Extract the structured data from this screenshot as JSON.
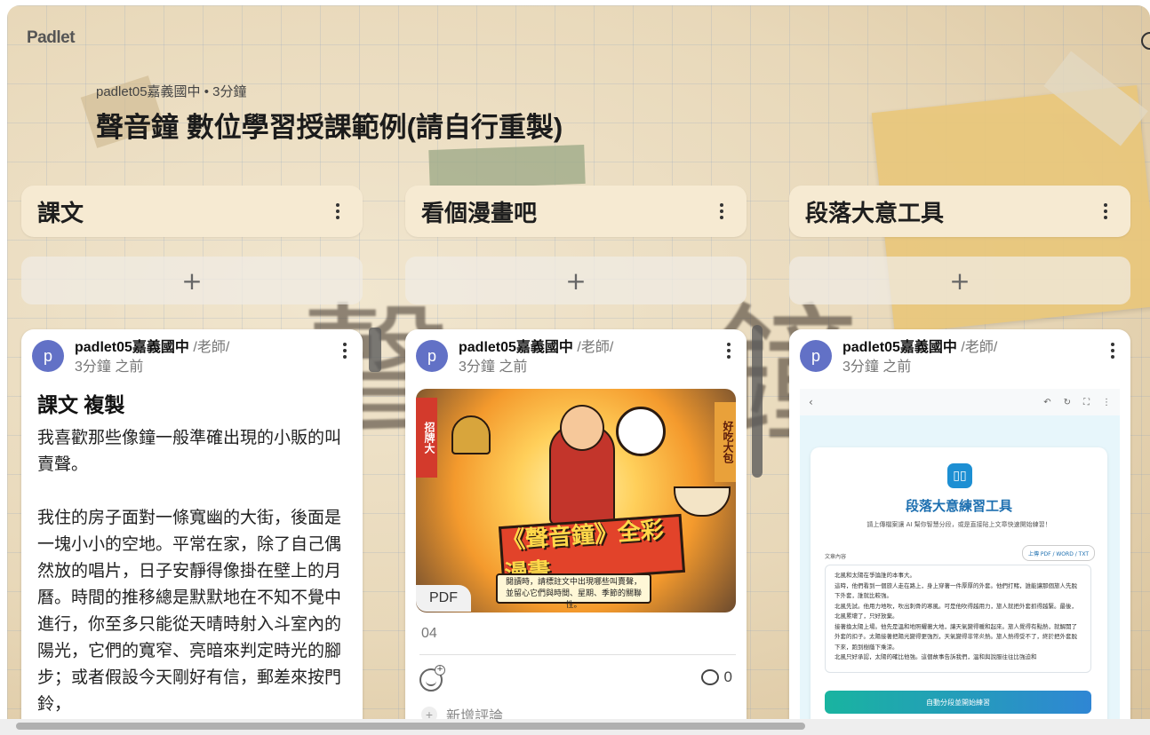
{
  "app": {
    "logo": "Padlet",
    "meta": "padlet05嘉義國中 • 3分鐘",
    "title": "聲音鐘 數位學習授課範例(請自行重製)"
  },
  "columns": [
    {
      "title": "課文",
      "add_symbol": "+",
      "post": {
        "avatar_letter": "p",
        "author": "padlet05嘉義國中",
        "role": "/老師/",
        "time": "3分鐘 之前",
        "title": "課文 複製",
        "body": "我喜歡那些像鐘一般準確出現的小販的叫賣聲。\n\n我住的房子面對一條寬幽的大街，後面是一塊小小的空地。平常在家，除了自己偶然放的唱片，日子安靜得像掛在壁上的月曆。時間的推移總是默默地在不知不覺中進行，你至多只能從天晴時射入斗室內的陽光，它們的寬窄、亮暗來判定時光的腳步；或者假設今天剛好有信，郵差來按門鈴，"
      }
    },
    {
      "title": "看個漫畫吧",
      "add_symbol": "+",
      "post": {
        "avatar_letter": "p",
        "author": "padlet05嘉義國中",
        "role": "/老師/",
        "time": "3分鐘 之前",
        "attachment": {
          "type_label": "PDF",
          "filename": "04",
          "headline": "《聲音鐘》全彩漫畫",
          "caption": "閱讀時，請標註文中出現哪些叫賣聲，並留心它們與時間、星期、季節的關聯性。",
          "sign_left": "招牌大",
          "sign_right": "好吃大包"
        },
        "comment_count": "0",
        "add_comment": "新增評論"
      }
    },
    {
      "title": "段落大意工具",
      "add_symbol": "+",
      "post": {
        "avatar_letter": "p",
        "author": "padlet05嘉義國中",
        "role": "/老師/",
        "time": "3分鐘 之前",
        "tool": {
          "back": "‹",
          "title": "段落大意練習工具",
          "subtitle": "請上傳檔案讓 AI 幫你智慧分段，或是直接貼上文章快速開始練習！",
          "label": "文章內容",
          "upload": "上傳 PDF / WORD / TXT",
          "text": "北風和太陽在爭論誰的本事大。\n這時，他們看到一個旅人走在路上，身上穿著一件厚厚的外套。他們打賭，誰能讓那個旅人先脫下外套，誰就比較強。\n北風先試。他用力地吹，吹出刺骨的寒風。可是他吹得越用力，旅人就把外套抓得越緊。最後，北風累壞了，只好放棄。\n接著換太陽上場。他先是溫和地照耀著大地，讓天氣變得暖和起來。旅人覺得有點熱，就解開了外套的扣子。太陽接著把陽光變得更強烈，天氣變得非常炎熱。旅人熱得受不了，終於把外套脫下來，跑到樹蔭下乘涼。\n北風只好承認，太陽的確比他強。這個故事告訴我們，溫和與說服往往比強迫和",
          "button": "自動分段並開始練習"
        }
      }
    }
  ]
}
